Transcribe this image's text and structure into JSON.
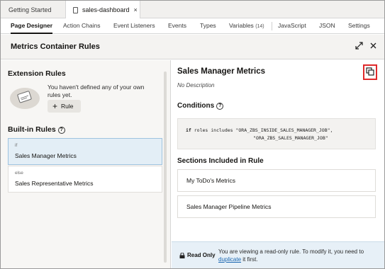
{
  "file_tabs": [
    {
      "label": "Getting Started"
    },
    {
      "label": "sales-dashboard"
    }
  ],
  "sub_tabs": [
    {
      "label": "Page Designer"
    },
    {
      "label": "Action Chains"
    },
    {
      "label": "Event Listeners"
    },
    {
      "label": "Events"
    },
    {
      "label": "Types"
    },
    {
      "label": "Variables",
      "count": "(14)"
    },
    {
      "label": "JavaScript"
    },
    {
      "label": "JSON"
    },
    {
      "label": "Settings"
    }
  ],
  "panel": {
    "title": "Metrics Container Rules"
  },
  "extension_rules": {
    "title": "Extension Rules",
    "empty_text": "You haven't defined any of your own rules yet.",
    "add_button": "Rule"
  },
  "builtin_rules": {
    "title": "Built-in Rules",
    "items": [
      {
        "keyword": "if",
        "name": "Sales Manager Metrics"
      },
      {
        "keyword": "else",
        "name": "Sales Representative Metrics"
      }
    ]
  },
  "detail": {
    "title": "Sales Manager Metrics",
    "description": "No Description",
    "conditions_title": "Conditions",
    "condition": {
      "keyword": "if",
      "field": "roles",
      "operator": "includes",
      "values": [
        "\"ORA_ZBS_INSIDE_SALES_MANAGER_JOB\",",
        "\"ORA_ZBS_SALES_MANAGER_JOB\""
      ]
    },
    "sections_title": "Sections Included in Rule",
    "sections": [
      {
        "name": "My ToDo's Metrics"
      },
      {
        "name": "Sales Manager Pipeline Metrics"
      }
    ]
  },
  "banner": {
    "label": "Read Only",
    "message_before": "You are viewing a read-only rule. To modify it, you need to ",
    "link": "duplicate",
    "message_after": " it first."
  },
  "icons": {
    "doc": "document-icon",
    "expand": "expand-icon",
    "close": "close-icon",
    "copy": "duplicate-icon",
    "info": "info-icon",
    "lock": "lock-icon"
  },
  "colors": {
    "selected_bg": "#e3eef6",
    "highlight": "#e0292b",
    "link": "#1a66b0",
    "banner_bg": "#e7f0f7"
  }
}
